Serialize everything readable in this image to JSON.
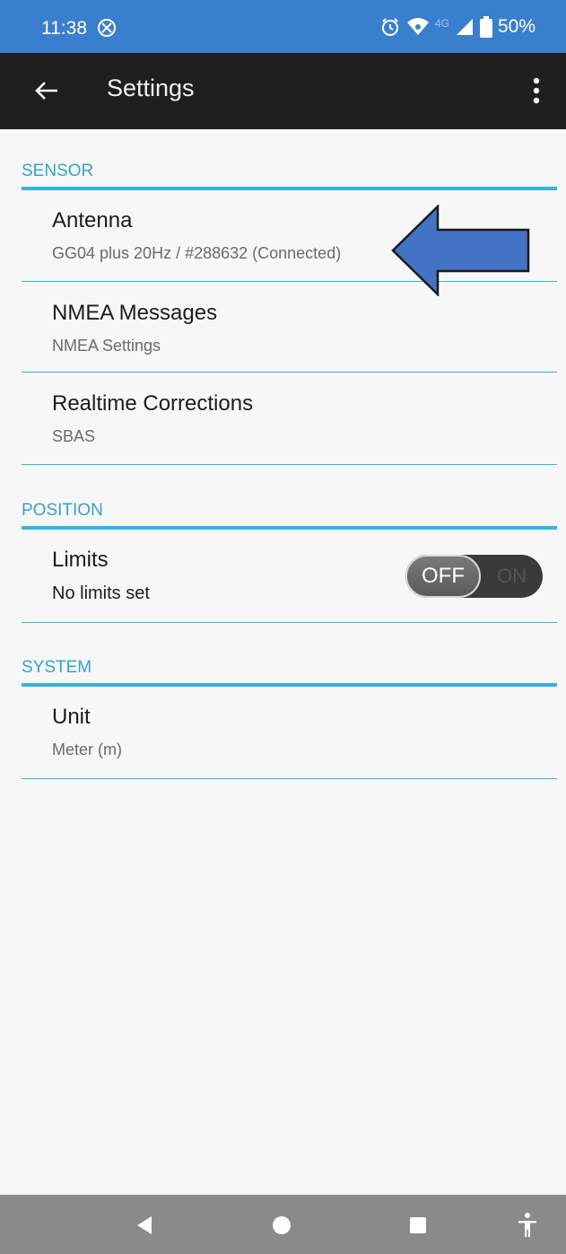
{
  "status_bar": {
    "time": "11:38",
    "network_label": "4G",
    "battery": "50%",
    "icons": [
      "do-not-disturb-icon",
      "alarm-icon",
      "wifi-icon",
      "signal-icon",
      "battery-icon"
    ]
  },
  "app_bar": {
    "title": "Settings",
    "back_icon": "arrow-back-icon",
    "more_icon": "more-vert-icon"
  },
  "sections": {
    "sensor": {
      "header": "SENSOR",
      "items": [
        {
          "title": "Antenna",
          "summary": "GG04 plus 20Hz / #288632 (Connected)"
        },
        {
          "title": "NMEA Messages",
          "summary": "NMEA Settings"
        },
        {
          "title": "Realtime Corrections",
          "summary": "SBAS"
        }
      ]
    },
    "position": {
      "header": "POSITION",
      "items": [
        {
          "title": "Limits",
          "summary": "No limits set",
          "toggle": {
            "off_label": "OFF",
            "on_label": "ON",
            "state": "off"
          }
        }
      ]
    },
    "system": {
      "header": "SYSTEM",
      "items": [
        {
          "title": "Unit",
          "summary": "Meter (m)"
        }
      ]
    }
  },
  "colors": {
    "status_bar": "#3a7fce",
    "app_bar": "#1f1f1f",
    "accent": "#33b5dc",
    "arrow_fill": "#4472c4",
    "nav_bar": "#8a8a8a"
  },
  "nav_bar": {
    "buttons": [
      "back-triangle-icon",
      "home-circle-icon",
      "recents-square-icon",
      "accessibility-icon"
    ]
  }
}
